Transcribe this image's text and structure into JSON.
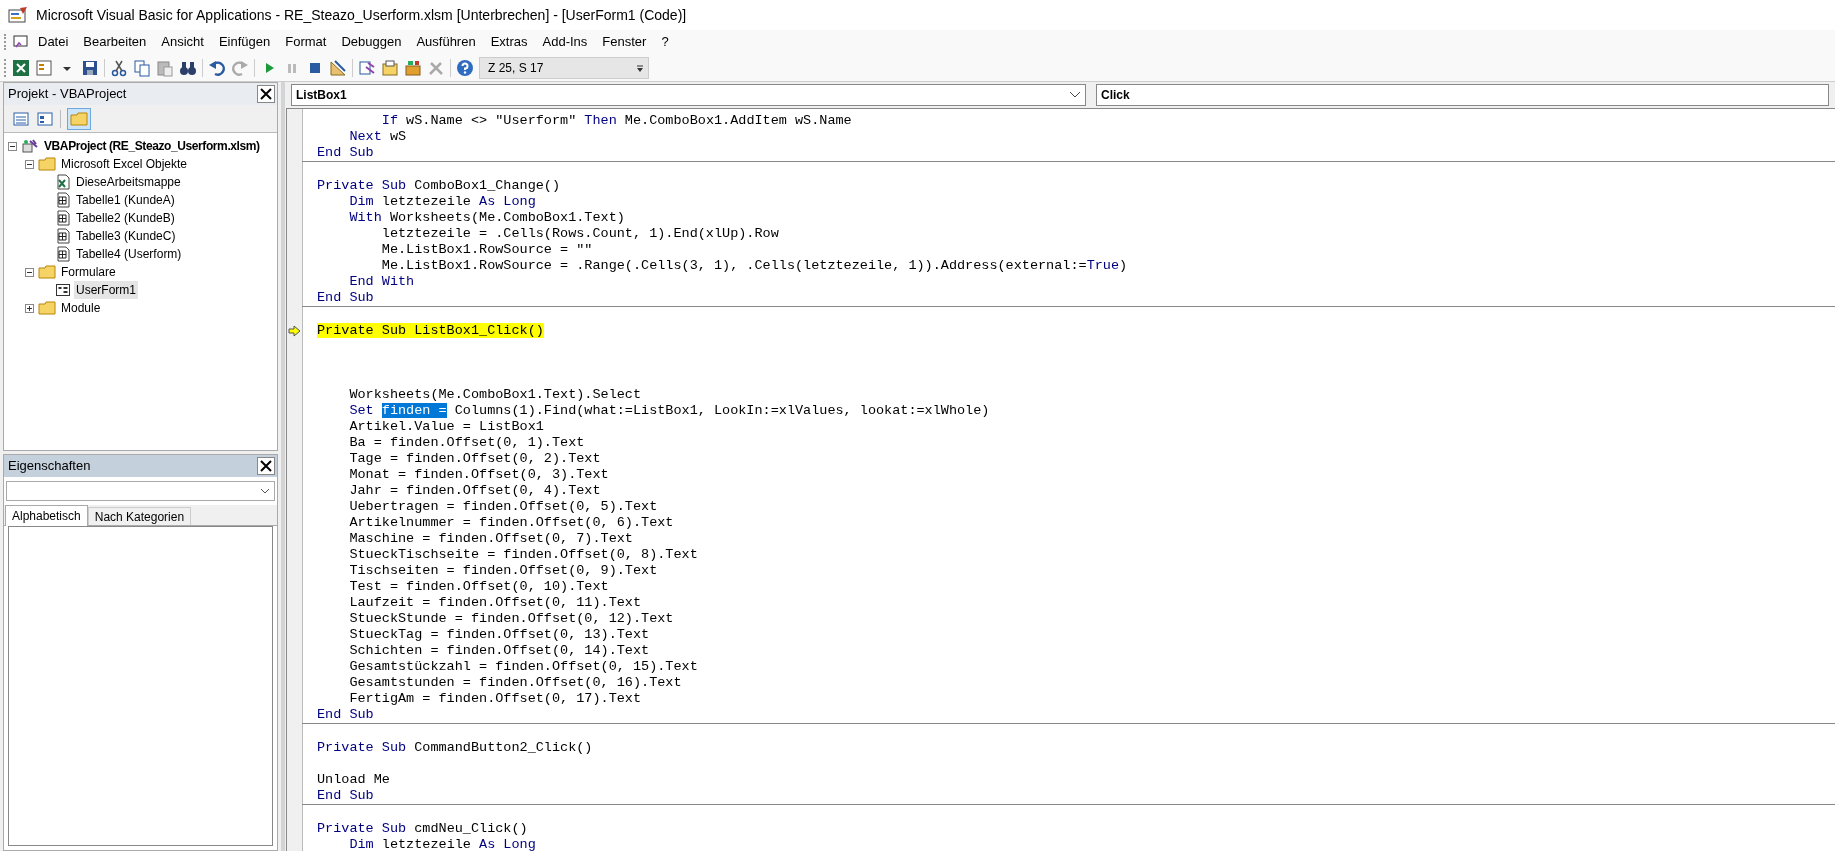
{
  "window": {
    "title": "Microsoft Visual Basic for Applications - RE_Steazo_Userform.xlsm [Unterbrechen] - [UserForm1 (Code)]"
  },
  "menu": [
    {
      "label": "Datei"
    },
    {
      "label": "Bearbeiten"
    },
    {
      "label": "Ansicht"
    },
    {
      "label": "Einfügen"
    },
    {
      "label": "Format"
    },
    {
      "label": "Debuggen"
    },
    {
      "label": "Ausführen"
    },
    {
      "label": "Extras"
    },
    {
      "label": "Add-Ins"
    },
    {
      "label": "Fenster"
    },
    {
      "label": "?"
    }
  ],
  "toolbar": {
    "position": "Z 25, S 17"
  },
  "project": {
    "title": "Projekt - VBAProject",
    "tree": [
      {
        "label": "VBAProject (RE_Steazo_Userform.xlsm)",
        "kind": "project",
        "expanded": true,
        "selected": false,
        "children": [
          {
            "label": "Microsoft Excel Objekte",
            "kind": "folder",
            "expanded": true,
            "selected": false,
            "children": [
              {
                "label": "DieseArbeitsmappe",
                "kind": "workbook",
                "selected": false
              },
              {
                "label": "Tabelle1 (KundeA)",
                "kind": "sheet",
                "selected": false
              },
              {
                "label": "Tabelle2 (KundeB)",
                "kind": "sheet",
                "selected": false
              },
              {
                "label": "Tabelle3 (KundeC)",
                "kind": "sheet",
                "selected": false
              },
              {
                "label": "Tabelle4 (Userform)",
                "kind": "sheet",
                "selected": false
              }
            ]
          },
          {
            "label": "Formulare",
            "kind": "folder",
            "expanded": true,
            "selected": false,
            "children": [
              {
                "label": "UserForm1",
                "kind": "form",
                "selected": true
              }
            ]
          },
          {
            "label": "Module",
            "kind": "folder",
            "expanded": false,
            "selected": false
          }
        ]
      }
    ]
  },
  "properties": {
    "title": "Eigenschaften",
    "tabs": [
      {
        "label": "Alphabetisch",
        "selected": true
      },
      {
        "label": "Nach Kategorien",
        "selected": false
      }
    ]
  },
  "code": {
    "object": "ListBox1",
    "procedure": "Click",
    "procedures": [
      {
        "lines": [
          {
            "kind": "code",
            "segments": [
              {
                "text": "        If",
                "kind": "keyword"
              },
              {
                "text": " wS.Name <> \"Userform\" ",
                "kind": "plain"
              },
              {
                "text": "Then",
                "kind": "keyword"
              },
              {
                "text": " Me.ComboBox1.AddItem wS.Name",
                "kind": "plain"
              }
            ]
          },
          {
            "kind": "code",
            "segments": [
              {
                "text": "    Next",
                "kind": "keyword"
              },
              {
                "text": " wS",
                "kind": "plain"
              }
            ]
          },
          {
            "kind": "code",
            "segments": [
              {
                "text": "End Sub",
                "kind": "keyword"
              }
            ]
          }
        ]
      },
      {
        "lines": [
          {
            "kind": "blank"
          },
          {
            "kind": "code",
            "segments": [
              {
                "text": "Private Sub",
                "kind": "keyword"
              },
              {
                "text": " ComboBox1_Change()",
                "kind": "plain"
              }
            ]
          },
          {
            "kind": "code",
            "segments": [
              {
                "text": "    Dim",
                "kind": "keyword"
              },
              {
                "text": " letztezeile ",
                "kind": "plain"
              },
              {
                "text": "As Long",
                "kind": "keyword"
              }
            ]
          },
          {
            "kind": "code",
            "segments": [
              {
                "text": "    With",
                "kind": "keyword"
              },
              {
                "text": " Worksheets(Me.ComboBox1.Text)",
                "kind": "plain"
              }
            ]
          },
          {
            "kind": "code",
            "segments": [
              {
                "text": "        letztezeile = .Cells(Rows.Count, 1).End(xlUp).Row",
                "kind": "plain"
              }
            ]
          },
          {
            "kind": "code",
            "segments": [
              {
                "text": "        Me.ListBox1.RowSource = \"\"",
                "kind": "plain"
              }
            ]
          },
          {
            "kind": "code",
            "segments": [
              {
                "text": "        Me.ListBox1.RowSource = .Range(.Cells(3, 1), .Cells(letztezeile, 1)).Address(external:=",
                "kind": "plain"
              },
              {
                "text": "True",
                "kind": "keyword"
              },
              {
                "text": ")",
                "kind": "plain"
              }
            ]
          },
          {
            "kind": "code",
            "segments": [
              {
                "text": "    End With",
                "kind": "keyword"
              }
            ]
          },
          {
            "kind": "code",
            "segments": [
              {
                "text": "End Sub",
                "kind": "keyword"
              }
            ]
          }
        ]
      },
      {
        "lines": [
          {
            "kind": "blank"
          },
          {
            "kind": "current",
            "segments": [
              {
                "text": "Private Sub ListBox1_Click()",
                "kind": "plain"
              }
            ]
          },
          {
            "kind": "blank"
          },
          {
            "kind": "blank"
          },
          {
            "kind": "blank"
          },
          {
            "kind": "code",
            "segments": [
              {
                "text": "    Worksheets(Me.ComboBox1.Text).Select",
                "kind": "plain"
              }
            ]
          },
          {
            "kind": "code",
            "segments": [
              {
                "text": "    Set ",
                "kind": "keyword"
              },
              {
                "text": "finden =",
                "kind": "selected"
              },
              {
                "text": " Columns(1).Find(what:=ListBox1, LookIn:=xlValues, lookat:=xlWhole)",
                "kind": "plain"
              }
            ]
          },
          {
            "kind": "code",
            "segments": [
              {
                "text": "    Artikel.Value = ListBox1",
                "kind": "plain"
              }
            ]
          },
          {
            "kind": "code",
            "segments": [
              {
                "text": "    Ba = finden.Offset(0, 1).Text",
                "kind": "plain"
              }
            ]
          },
          {
            "kind": "code",
            "segments": [
              {
                "text": "    Tage = finden.Offset(0, 2).Text",
                "kind": "plain"
              }
            ]
          },
          {
            "kind": "code",
            "segments": [
              {
                "text": "    Monat = finden.Offset(0, 3).Text",
                "kind": "plain"
              }
            ]
          },
          {
            "kind": "code",
            "segments": [
              {
                "text": "    Jahr = finden.Offset(0, 4).Text",
                "kind": "plain"
              }
            ]
          },
          {
            "kind": "code",
            "segments": [
              {
                "text": "    Uebertragen = finden.Offset(0, 5).Text",
                "kind": "plain"
              }
            ]
          },
          {
            "kind": "code",
            "segments": [
              {
                "text": "    Artikelnummer = finden.Offset(0, 6).Text",
                "kind": "plain"
              }
            ]
          },
          {
            "kind": "code",
            "segments": [
              {
                "text": "    Maschine = finden.Offset(0, 7).Text",
                "kind": "plain"
              }
            ]
          },
          {
            "kind": "code",
            "segments": [
              {
                "text": "    StueckTischseite = finden.Offset(0, 8).Text",
                "kind": "plain"
              }
            ]
          },
          {
            "kind": "code",
            "segments": [
              {
                "text": "    Tischseiten = finden.Offset(0, 9).Text",
                "kind": "plain"
              }
            ]
          },
          {
            "kind": "code",
            "segments": [
              {
                "text": "    Test = finden.Offset(0, 10).Text",
                "kind": "plain"
              }
            ]
          },
          {
            "kind": "code",
            "segments": [
              {
                "text": "    Laufzeit = finden.Offset(0, 11).Text",
                "kind": "plain"
              }
            ]
          },
          {
            "kind": "code",
            "segments": [
              {
                "text": "    StueckStunde = finden.Offset(0, 12).Text",
                "kind": "plain"
              }
            ]
          },
          {
            "kind": "code",
            "segments": [
              {
                "text": "    StueckTag = finden.Offset(0, 13).Text",
                "kind": "plain"
              }
            ]
          },
          {
            "kind": "code",
            "segments": [
              {
                "text": "    Schichten = finden.Offset(0, 14).Text",
                "kind": "plain"
              }
            ]
          },
          {
            "kind": "code",
            "segments": [
              {
                "text": "    Gesamtstückzahl = finden.Offset(0, 15).Text",
                "kind": "plain"
              }
            ]
          },
          {
            "kind": "code",
            "segments": [
              {
                "text": "    Gesamtstunden = finden.Offset(0, 16).Text",
                "kind": "plain"
              }
            ]
          },
          {
            "kind": "code",
            "segments": [
              {
                "text": "    FertigAm = finden.Offset(0, 17).Text",
                "kind": "plain"
              }
            ]
          },
          {
            "kind": "code",
            "segments": [
              {
                "text": "End Sub",
                "kind": "keyword"
              }
            ]
          }
        ]
      },
      {
        "lines": [
          {
            "kind": "blank"
          },
          {
            "kind": "code",
            "segments": [
              {
                "text": "Private Sub",
                "kind": "keyword"
              },
              {
                "text": " CommandButton2_Click()",
                "kind": "plain"
              }
            ]
          },
          {
            "kind": "blank"
          },
          {
            "kind": "code",
            "segments": [
              {
                "text": "Unload Me",
                "kind": "plain"
              }
            ]
          },
          {
            "kind": "code",
            "segments": [
              {
                "text": "End Sub",
                "kind": "keyword"
              }
            ]
          }
        ]
      },
      {
        "lines": [
          {
            "kind": "blank"
          },
          {
            "kind": "code",
            "segments": [
              {
                "text": "Private Sub",
                "kind": "keyword"
              },
              {
                "text": " cmdNeu_Click()",
                "kind": "plain"
              }
            ]
          },
          {
            "kind": "code",
            "segments": [
              {
                "text": "    Dim",
                "kind": "keyword"
              },
              {
                "text": " letztezeile ",
                "kind": "plain"
              },
              {
                "text": "As Long",
                "kind": "keyword"
              }
            ]
          }
        ]
      }
    ]
  }
}
